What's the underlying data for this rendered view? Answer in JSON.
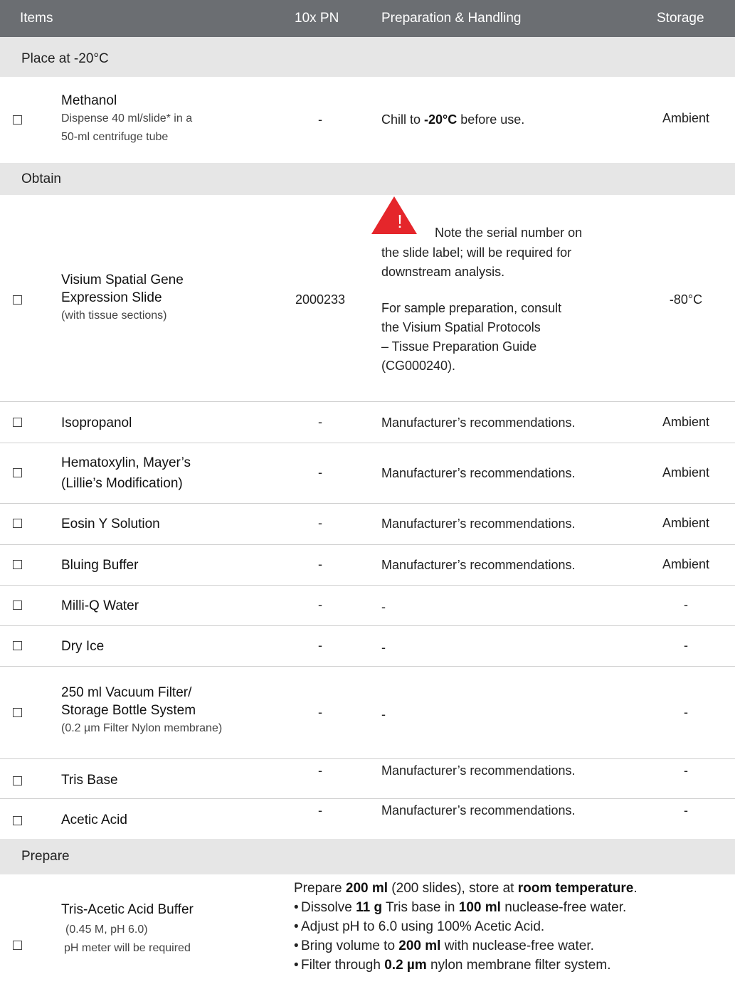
{
  "header": {
    "items": "Items",
    "pn": "10x PN",
    "prep": "Preparation & Handling",
    "storage": "Storage"
  },
  "sections": {
    "place": "Place at -20°C",
    "obtain": "Obtain",
    "prepare": "Prepare"
  },
  "methanol": {
    "name": "Methanol",
    "desc1": "Dispense 40 ml/slide* in a",
    "desc2": "50-ml centrifuge tube",
    "pn": "-",
    "prep_pre": "Chill to ",
    "prep_bold": "-20°C",
    "prep_post": " before use.",
    "storage": "Ambient"
  },
  "visium": {
    "name1": "Visium Spatial Gene",
    "name2": "Expression  Slide",
    "sub": "(with tissue sections)",
    "pn": "2000233",
    "note1": "Note the serial number on",
    "note2": "the slide label; will be required for",
    "note3": "downstream analysis.",
    "note4": "For sample preparation, consult",
    "note5": "the Visium Spatial Protocols",
    "note6": "– Tissue Preparation Guide",
    "note7": "(CG000240).",
    "storage": "-80°C",
    "warn_mark": "!"
  },
  "isopropanol": {
    "name": "Isopropanol",
    "pn": "-",
    "prep": "Manufacturer’s recommendations.",
    "storage": "Ambient"
  },
  "hematoxylin": {
    "name1": "Hematoxylin, Mayer’s",
    "name2": "(Lillie’s Modification)",
    "pn": "-",
    "prep": "Manufacturer’s recommendations.",
    "storage": "Ambient"
  },
  "eosin": {
    "name": "Eosin Y Solution",
    "pn": "-",
    "prep": "Manufacturer’s recommendations.",
    "storage": "Ambient"
  },
  "bluing": {
    "name": "Bluing Buffer",
    "pn": "-",
    "prep": "Manufacturer’s recommendations.",
    "storage": "Ambient"
  },
  "milliq": {
    "name": "Milli-Q Water",
    "pn": "-",
    "prep": "-",
    "storage": "-"
  },
  "dryice": {
    "name": "Dry Ice",
    "pn": "-",
    "prep": "-",
    "storage": "-"
  },
  "filter": {
    "name1": "250 ml Vacuum Filter/",
    "name2": "Storage Bottle System",
    "sub": "(0.2 µm Filter Nylon membrane)",
    "pn": "-",
    "prep": "-",
    "storage": "-"
  },
  "tris": {
    "name": "Tris Base",
    "pn": "-",
    "prep": "Manufacturer’s recommendations.",
    "storage": "-"
  },
  "acetic": {
    "name": "Acetic Acid",
    "pn": "-",
    "prep": "Manufacturer’s recommendations.",
    "storage": "-"
  },
  "buffer": {
    "name": "Tris-Acetic Acid Buffer",
    "sub1": "(0.45 M, pH 6.0)",
    "sub2": "pH meter will be required",
    "intro_a": "Prepare ",
    "intro_b": "200 ml",
    "intro_c": " (200 slides), store at ",
    "intro_d": "room temperature",
    "intro_e": ".",
    "b1_a": "Dissolve ",
    "b1_b": "11 g",
    "b1_c": " Tris base in ",
    "b1_d": "100 ml",
    "b1_e": " nuclease-free water.",
    "b2": "Adjust pH to 6.0 using 100% Acetic Acid.",
    "b3_a": "Bring volume to ",
    "b3_b": "200 ml",
    "b3_c": " with nuclease-free water.",
    "b4_a": "Filter through ",
    "b4_b": "0.2 µm",
    "b4_c": " nylon membrane filter system.",
    "bullet": "•"
  },
  "colors": {
    "header_bg": "#6b6e72",
    "section_bg": "#e6e6e6",
    "warning_red": "#e5262b"
  }
}
